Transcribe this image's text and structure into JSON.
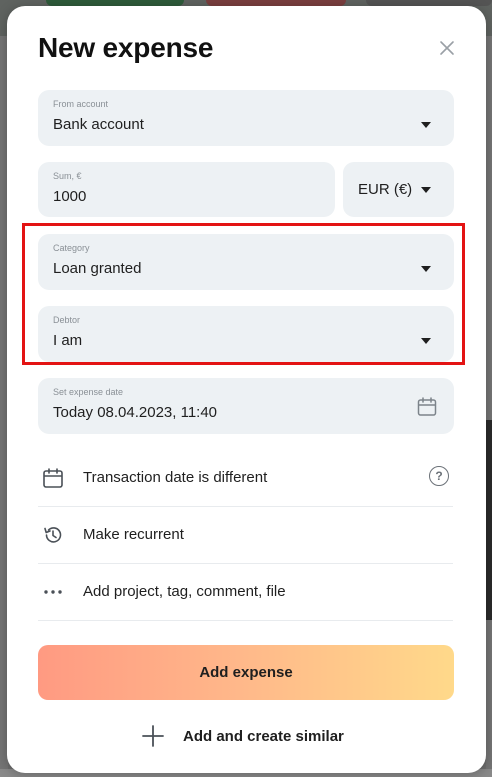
{
  "modal": {
    "title": "New expense",
    "close_icon": "close-icon"
  },
  "from_account": {
    "label": "From account",
    "value": "Bank account"
  },
  "sum": {
    "label": "Sum, €",
    "value": "1000"
  },
  "currency": {
    "value": "EUR (€)"
  },
  "category": {
    "label": "Category",
    "value": "Loan granted"
  },
  "debtor": {
    "label": "Debtor",
    "value": "I am"
  },
  "expense_date": {
    "label": "Set expense date",
    "value": "Today 08.04.2023, 11:40"
  },
  "options": {
    "transaction_date": "Transaction date is different",
    "recurrent": "Make recurrent",
    "extras": "Add project, tag, comment, file"
  },
  "actions": {
    "add_expense": "Add expense",
    "add_similar": "Add and create similar"
  },
  "colors": {
    "highlight": "#e31313",
    "field_bg": "#edf1f4",
    "button_gradient_start": "#ff9a82",
    "button_gradient_end": "#ffd98a"
  }
}
